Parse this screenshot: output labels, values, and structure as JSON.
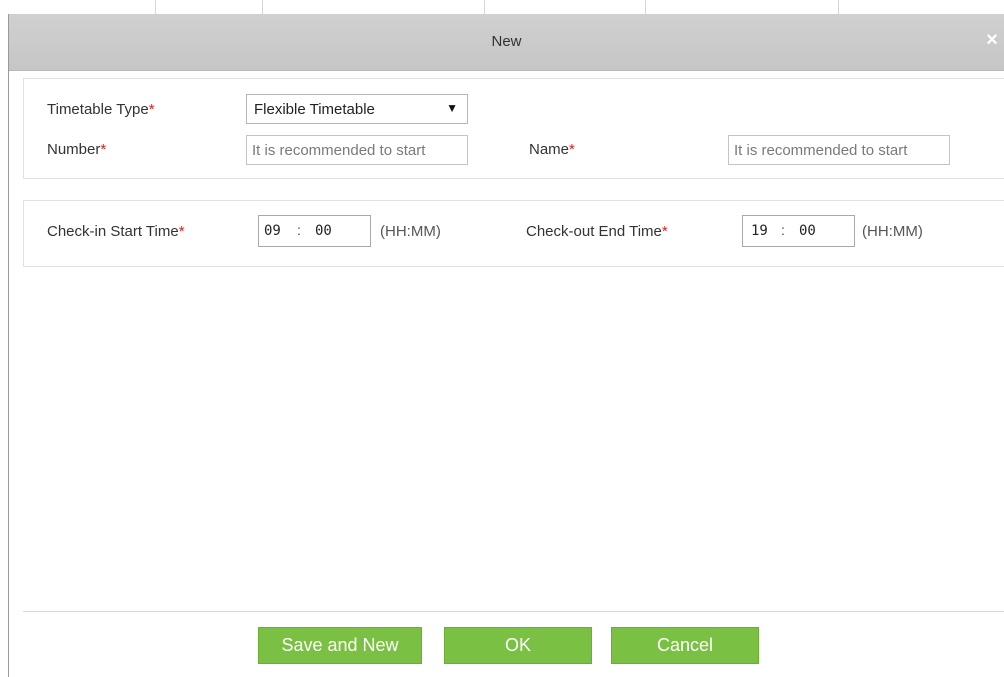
{
  "dialog": {
    "title": "New",
    "close_glyph": "×"
  },
  "form": {
    "required_marker": "*",
    "timetable_type": {
      "label": "Timetable Type",
      "value": "Flexible Timetable",
      "arrow_glyph": "▼"
    },
    "number": {
      "label": "Number",
      "placeholder": "It is recommended to start",
      "value": ""
    },
    "name": {
      "label": "Name",
      "placeholder": "It is recommended to start",
      "value": ""
    },
    "check_in_start": {
      "label": "Check-in Start Time",
      "hour": "09",
      "minute": "00",
      "separator": ":",
      "format_hint": "(HH:MM)"
    },
    "check_out_end": {
      "label": "Check-out End Time",
      "hour": "19",
      "minute": "00",
      "separator": ":",
      "format_hint": "(HH:MM)"
    }
  },
  "footer": {
    "save_and_new_label": "Save and New",
    "ok_label": "OK",
    "cancel_label": "Cancel"
  },
  "colors": {
    "button_green": "#7ac143",
    "required_red": "#e01c1c",
    "titlebar_gray": "#c8c8c8"
  }
}
